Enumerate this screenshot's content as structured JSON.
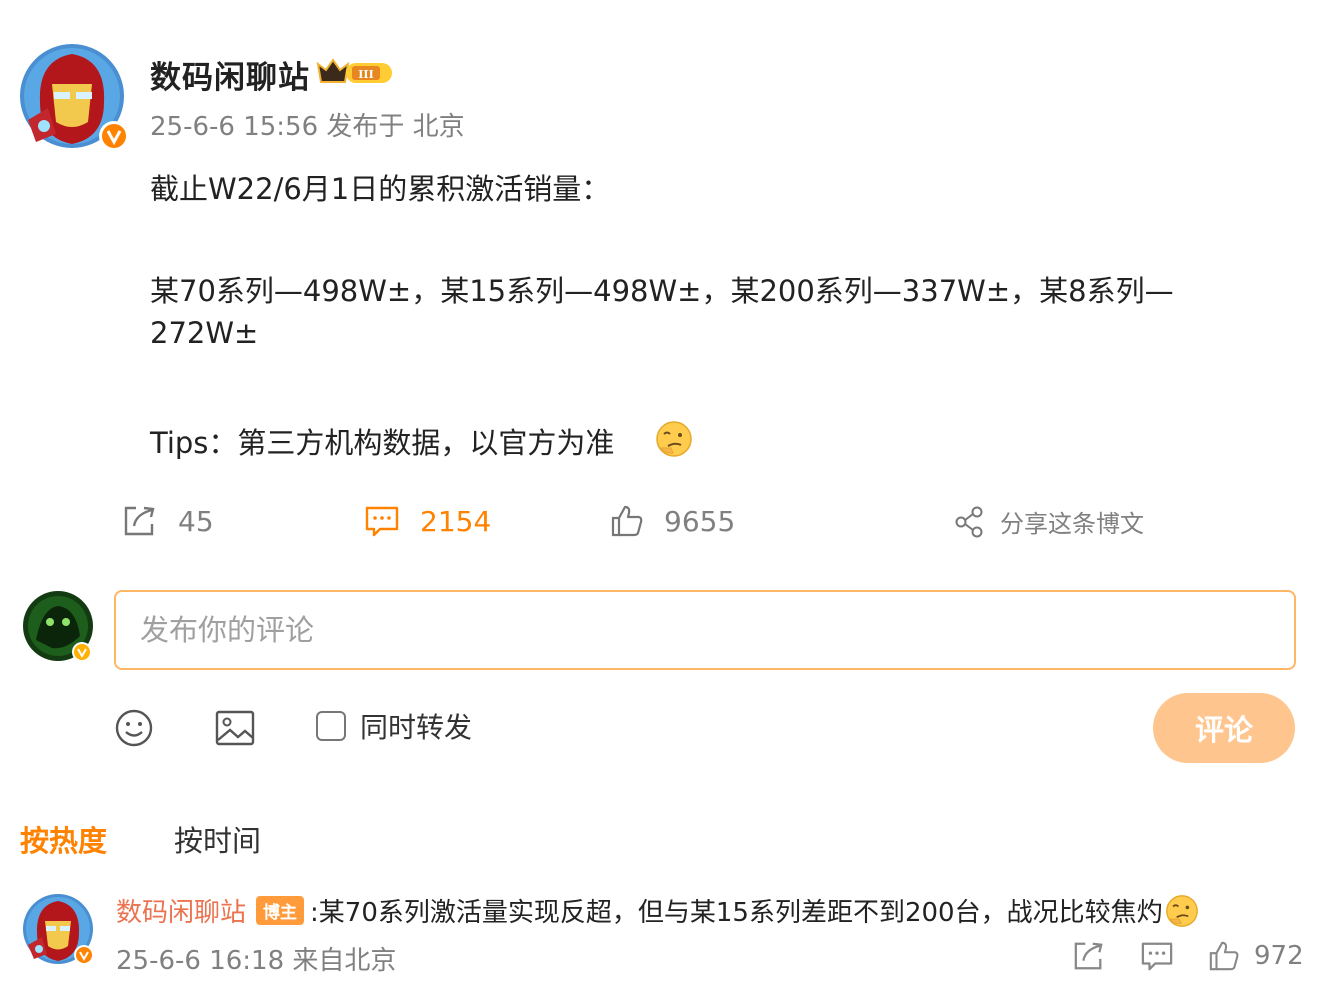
{
  "post": {
    "author": "数码闲聊站",
    "badge_icon": "crown-level-badge-icon",
    "meta": "25-6-6 15:56 发布于 北京",
    "lines": [
      "截止W22/6月1日的累积激活销量：",
      "某70系列—498W±，某15系列—498W±，某200系列—337W±，某8系列—",
      "272W±",
      "Tips：第三方机构数据，以官方为准"
    ],
    "emoji": "thinking-emoji-icon"
  },
  "actions": {
    "repost_count": "45",
    "comment_count": "2154",
    "like_count": "9655",
    "share_label": "分享这条博文"
  },
  "compose": {
    "placeholder": "发布你的评论",
    "repost_label": "同时转发",
    "submit_label": "评论"
  },
  "tabs": {
    "hot": "按热度",
    "time": "按时间"
  },
  "reply": {
    "author": "数码闲聊站",
    "badge": "博主",
    "text": ":某70系列激活量实现反超，但与某15系列差距不到200台，战况比较焦灼",
    "meta": "25-6-6 16:18 来自北京",
    "like_count": "972"
  },
  "colors": {
    "accent": "#ff8200",
    "submit_bg": "#ffc58f",
    "input_border": "#ffb766",
    "reply_author": "#eb7350"
  }
}
